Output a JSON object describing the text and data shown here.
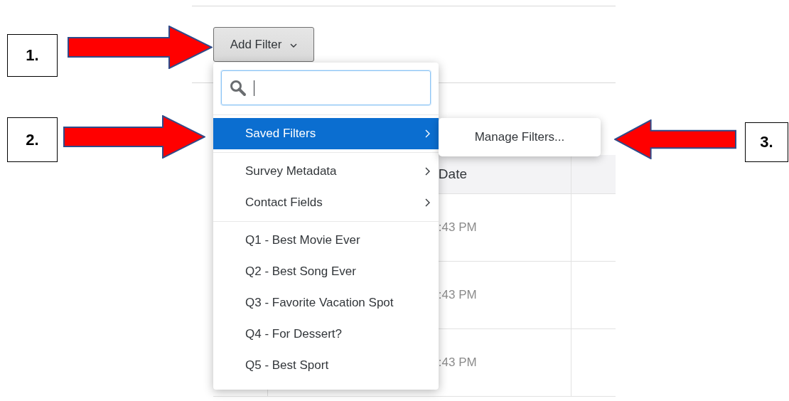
{
  "toolbar": {
    "add_filter_button": "Add Filter"
  },
  "filter_menu": {
    "search_field": {
      "focused": true
    },
    "sections": [
      [
        {
          "label": "Saved Filters",
          "selected": true,
          "has_submenu": true
        }
      ],
      [
        {
          "label": "Survey Metadata",
          "selected": false,
          "has_submenu": true
        },
        {
          "label": "Contact Fields",
          "selected": false,
          "has_submenu": true
        }
      ],
      [
        {
          "label": "Q1 - Best Movie Ever",
          "selected": false,
          "has_submenu": false
        },
        {
          "label": "Q2 - Best Song Ever",
          "selected": false,
          "has_submenu": false
        },
        {
          "label": "Q3 - Favorite Vacation Spot",
          "selected": false,
          "has_submenu": false
        },
        {
          "label": "Q4 - For Dessert?",
          "selected": false,
          "has_submenu": false
        },
        {
          "label": "Q5 - Best Sport",
          "selected": false,
          "has_submenu": false
        }
      ]
    ]
  },
  "submenu": {
    "items": [
      {
        "label": "Manage Filters..."
      }
    ]
  },
  "table": {
    "column_header": "Date",
    "rows": [
      ":43 PM",
      ":43 PM",
      ":43 PM"
    ]
  },
  "callouts": [
    {
      "label": "1.",
      "kind": "right"
    },
    {
      "label": "2.",
      "kind": "right"
    },
    {
      "label": "3.",
      "kind": "left"
    }
  ]
}
